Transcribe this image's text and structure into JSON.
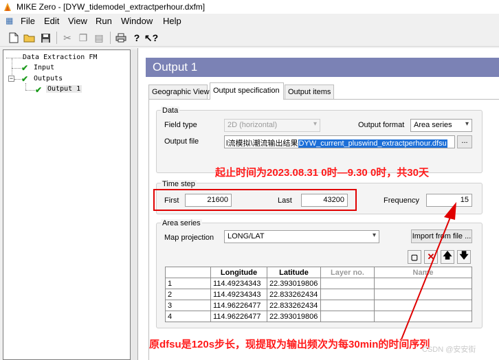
{
  "window": {
    "title": "MIKE Zero - [DYW_tidemodel_extractperhour.dxfm]"
  },
  "menu": [
    "File",
    "Edit",
    "View",
    "Run",
    "Window",
    "Help"
  ],
  "tree": {
    "root": "Data Extraction FM",
    "input": "Input",
    "outputs": "Outputs",
    "output1": "Output 1"
  },
  "header": {
    "title": "Output 1"
  },
  "tabs": [
    "Geographic View",
    "Output specification",
    "Output items"
  ],
  "data_group": {
    "label": "Data",
    "field_type_label": "Field type",
    "field_type_value": "2D (horizontal)",
    "output_format_label": "Output format",
    "output_format_value": "Area series",
    "output_file_label": "Output file",
    "output_file_prefix": "l流模拟\\潮流输出结果",
    "output_file_name": "DYW_current_pluswind_extractperhour.dfsu",
    "browse_label": "..."
  },
  "annotations": {
    "top": "起止时间为2023.08.31 0时—9.30 0时，共30天",
    "bottom": "原dfsu是120s步长，现提取为输出频次为每30min的时间序列"
  },
  "time_step": {
    "label": "Time step",
    "first_label": "First",
    "first_value": "21600",
    "last_label": "Last",
    "last_value": "43200",
    "frequency_label": "Frequency",
    "frequency_value": "15"
  },
  "area_series": {
    "label": "Area series",
    "map_projection_label": "Map projection",
    "map_projection_value": "LONG/LAT",
    "import_button": "Import from file ...",
    "columns": [
      "Longitude",
      "Latitude",
      "Layer no.",
      "Name"
    ],
    "rows": [
      [
        "1",
        "114.49234343",
        "22.393019806",
        "",
        ""
      ],
      [
        "2",
        "114.49234343",
        "22.833262434",
        "",
        ""
      ],
      [
        "3",
        "114.96226477",
        "22.833262434",
        "",
        ""
      ],
      [
        "4",
        "114.96226477",
        "22.393019806",
        "",
        ""
      ]
    ]
  },
  "watermark": "CSDN @安安街",
  "colors": {
    "header_bg": "#7b82b5",
    "annotation": "#ff1a1a",
    "selection": "#1c6fd8"
  }
}
